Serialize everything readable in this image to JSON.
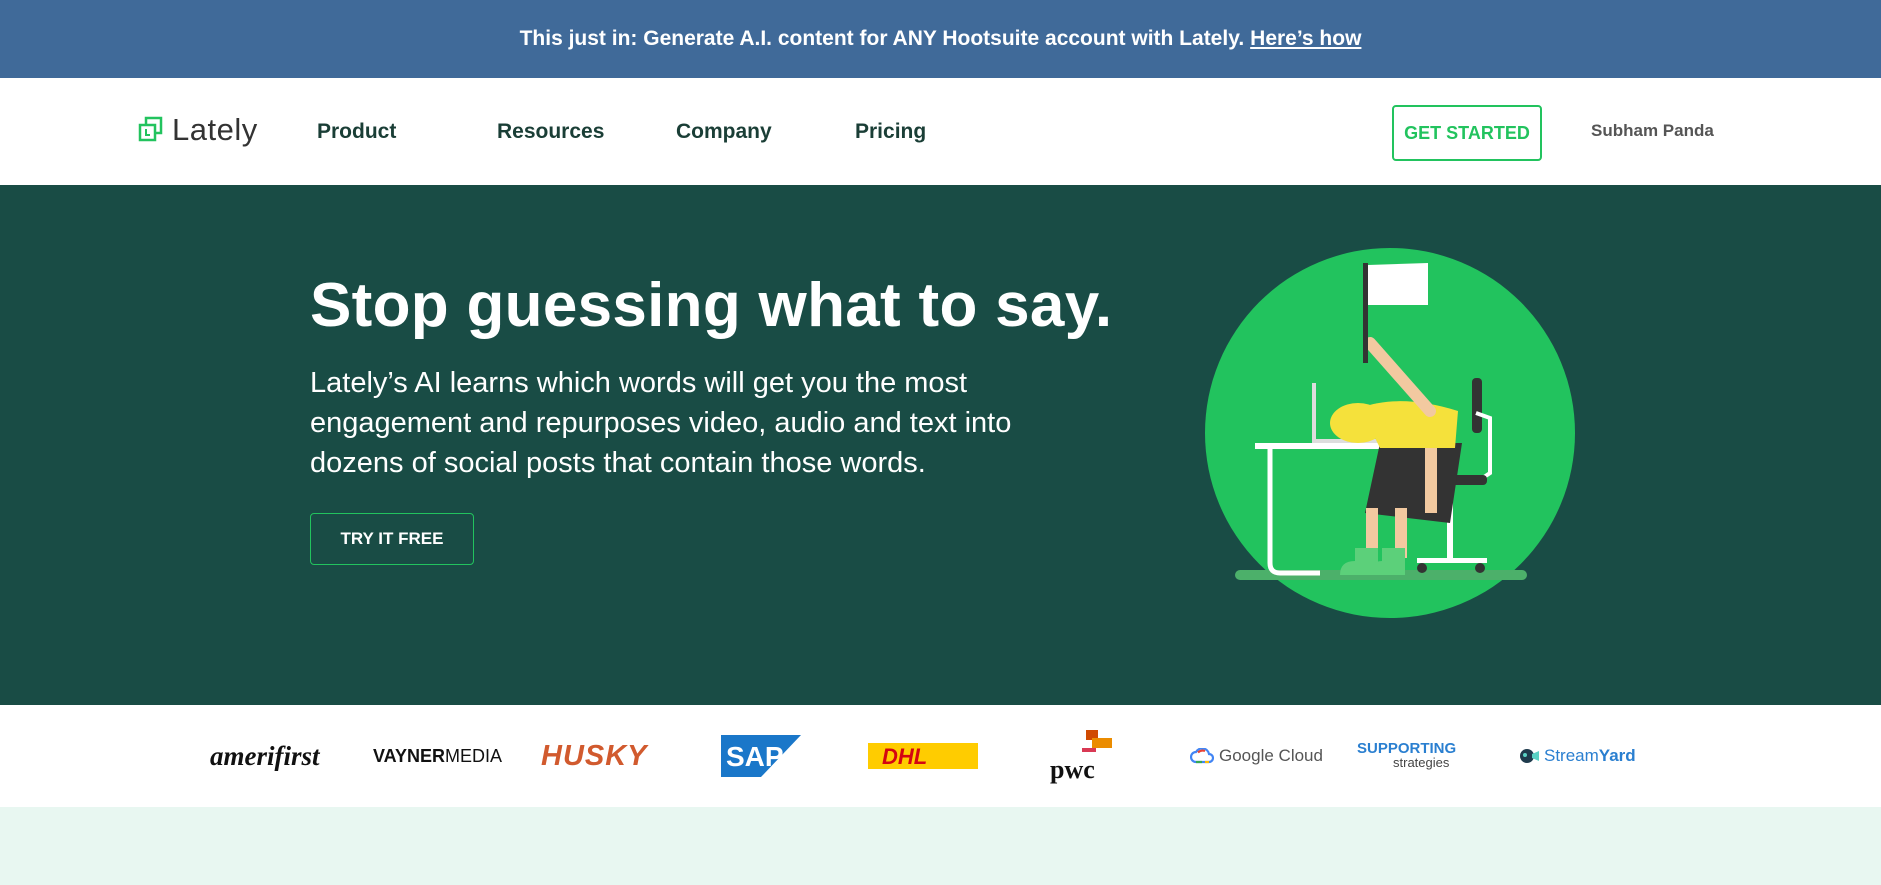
{
  "announcement": {
    "text": "This just in: Generate A.I. content for ANY Hootsuite account with Lately.",
    "link_label": "Here’s how"
  },
  "header": {
    "brand": "Lately",
    "nav": [
      "Product",
      "Resources",
      "Company",
      "Pricing"
    ],
    "cta_label": "GET STARTED",
    "user_name": "Subham Panda"
  },
  "hero": {
    "title": "Stop guessing what to say.",
    "subtitle": "Lately’s AI learns which words will get you the most engagement and repurposes video, audio and text into dozens of social posts that contain those words.",
    "cta_label": "TRY IT FREE"
  },
  "client_logos": {
    "amerifirst": "amerifirst",
    "vayner_bold": "VAYNER",
    "vayner_light": "MEDIA",
    "husky": "HUSKY",
    "sap": "SAP",
    "dhl": "DHL",
    "pwc": "pwc",
    "google_cloud": "Google Cloud",
    "supporting_1": "SUPPORTING",
    "supporting_2": "strategies",
    "streamyard_1": "Stream",
    "streamyard_2": "Yard"
  },
  "colors": {
    "announce_bg": "#406a99",
    "hero_bg": "#194c45",
    "accent_green": "#22c35e",
    "bottom_band": "#e8f7f1"
  }
}
